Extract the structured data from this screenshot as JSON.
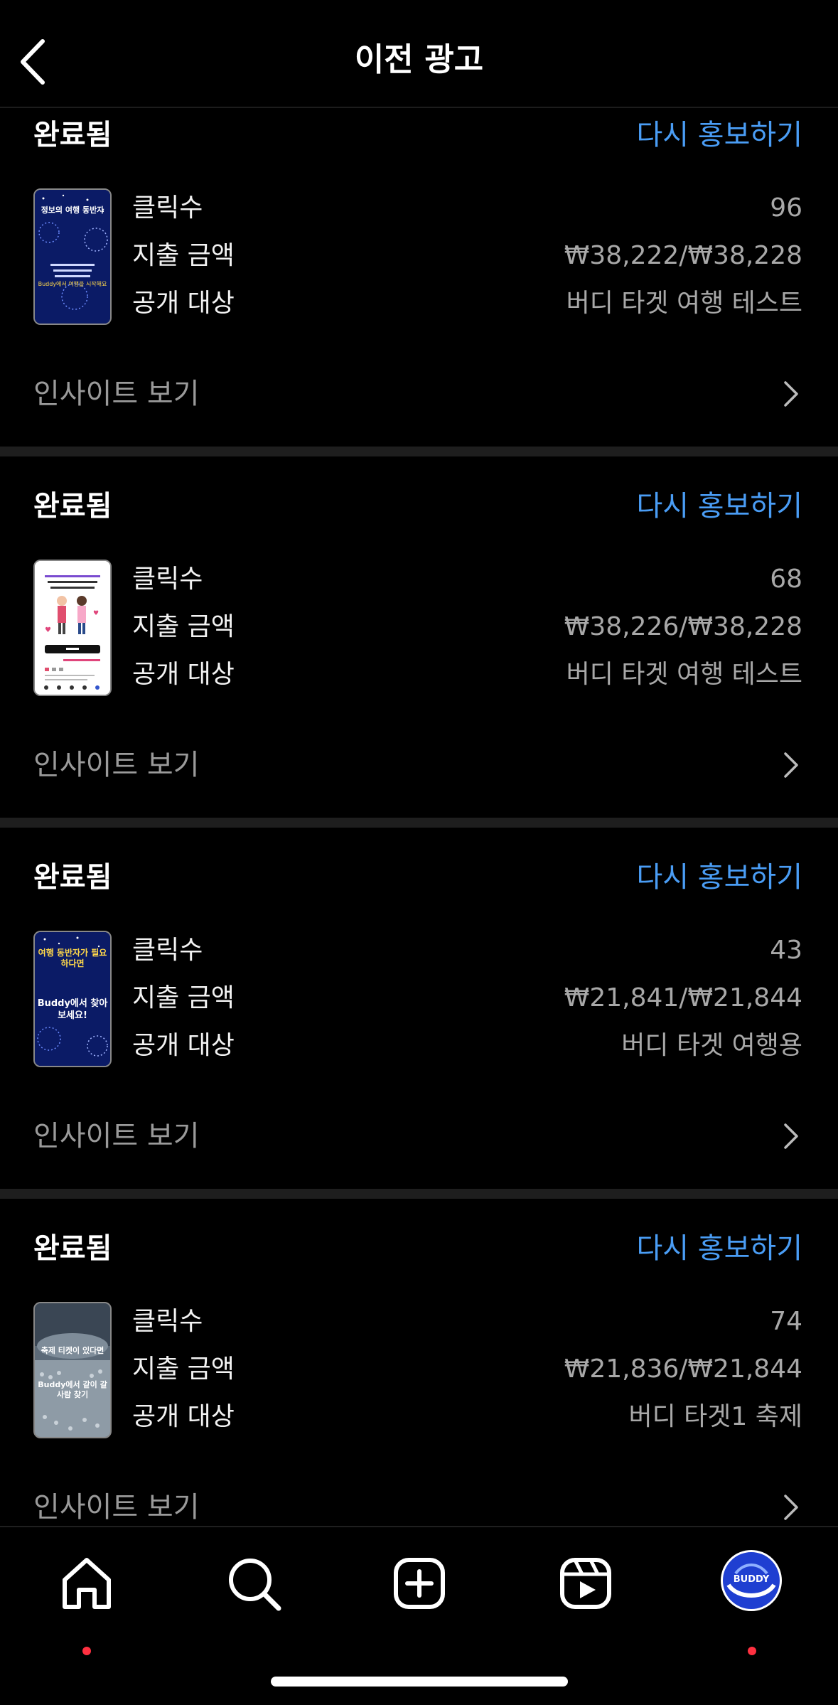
{
  "header": {
    "title": "이전 광고",
    "back_icon": "chevron-left-icon"
  },
  "ads": [
    {
      "status": "완료됨",
      "action": "다시 홍보하기",
      "thumbnail": {
        "texts": [
          "정보의 여행 동반자",
          "Buddy에서 여행을 시작해요"
        ]
      },
      "stats": [
        {
          "label": "클릭수",
          "value": "96"
        },
        {
          "label": "지출 금액",
          "value": "₩38,222/₩38,228"
        },
        {
          "label": "공개 대상",
          "value": "버디 타겟 여행 테스트"
        }
      ],
      "insight": "인사이트 보기"
    },
    {
      "status": "완료됨",
      "action": "다시 홍보하기",
      "thumbnail": {
        "texts": []
      },
      "stats": [
        {
          "label": "클릭수",
          "value": "68"
        },
        {
          "label": "지출 금액",
          "value": "₩38,226/₩38,228"
        },
        {
          "label": "공개 대상",
          "value": "버디 타겟 여행 테스트"
        }
      ],
      "insight": "인사이트 보기"
    },
    {
      "status": "완료됨",
      "action": "다시 홍보하기",
      "thumbnail": {
        "texts": [
          "여행 동반자가 필요하다면",
          "Buddy에서 찾아보세요!"
        ]
      },
      "stats": [
        {
          "label": "클릭수",
          "value": "43"
        },
        {
          "label": "지출 금액",
          "value": "₩21,841/₩21,844"
        },
        {
          "label": "공개 대상",
          "value": "버디 타겟 여행용"
        }
      ],
      "insight": "인사이트 보기"
    },
    {
      "status": "완료됨",
      "action": "다시 홍보하기",
      "thumbnail": {
        "texts": [
          "축제 티켓이 있다면",
          "Buddy에서 같이 갈 사람 찾기"
        ]
      },
      "stats": [
        {
          "label": "클릭수",
          "value": "74"
        },
        {
          "label": "지출 금액",
          "value": "₩21,836/₩21,844"
        },
        {
          "label": "공개 대상",
          "value": "버디 타겟1 축제"
        }
      ],
      "insight": "인사이트 보기"
    }
  ],
  "tabbar": {
    "tabs": [
      {
        "name": "home-icon",
        "notification": true
      },
      {
        "name": "search-icon",
        "notification": false
      },
      {
        "name": "create-icon",
        "notification": false
      },
      {
        "name": "reels-icon",
        "notification": false
      },
      {
        "name": "profile-avatar",
        "notification": true,
        "avatar_text": "BUDDY"
      }
    ]
  },
  "colors": {
    "accent": "#4a9df5",
    "background": "#000000",
    "notification": "#ff3040"
  }
}
